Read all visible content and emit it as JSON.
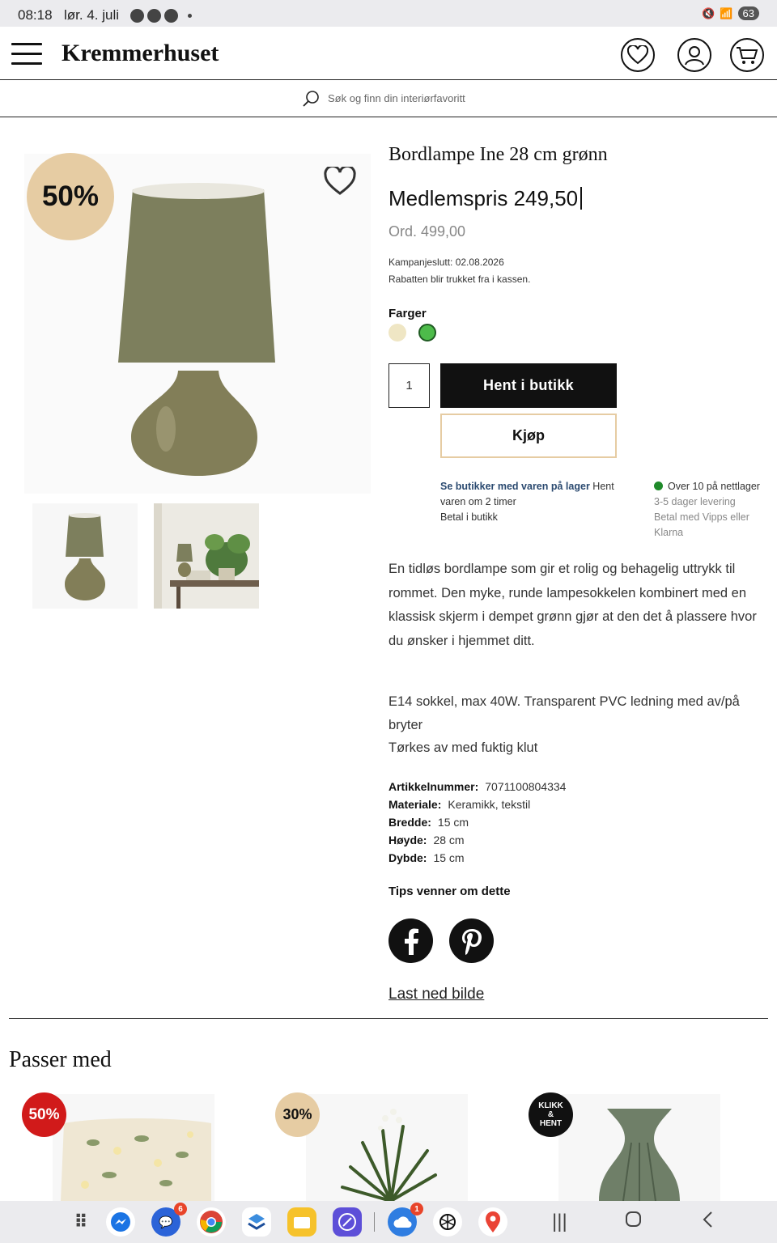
{
  "status_bar": {
    "time": "08:18",
    "date": "lør. 4. juli",
    "battery": "63"
  },
  "header": {
    "logo": "Kremmerhuset"
  },
  "search": {
    "placeholder": "Søk og finn din interiørfavoritt"
  },
  "product": {
    "discount_badge": "50%",
    "title": "Bordlampe Ine 28 cm grønn",
    "member_price": "Medlemspris 249,50",
    "ordinary_price": "Ord. 499,00",
    "campaign_end": "Kampanjeslutt: 02.08.2026",
    "discount_note": "Rabatten blir trukket fra i kassen.",
    "colors_label": "Farger",
    "colors": [
      "#efe6c4",
      "#4dbb4a"
    ],
    "quantity": "1",
    "pickup_button": "Hent i butikk",
    "buy_button": "Kjøp",
    "store_link": "Se butikker med varen på lager",
    "store_text_1": "Hent varen om 2 timer",
    "store_text_2": "Betal i butikk",
    "online_stock": "Over 10 på nettlager",
    "delivery": "3-5 dager levering",
    "payment": "Betal med Vipps eller Klarna",
    "description": "En tidløs bordlampe som gir et rolig og behagelig uttrykk til rommet. Den myke, runde lampesokkelen kombinert med en klassisk skjerm i dempet grønn gjør at den det å plassere hvor du ønsker i hjemmet ditt.",
    "description2_line1": "E14 sokkel, max 40W. Transparent PVC ledning med av/på bryter",
    "description2_line2": "Tørkes av med fuktig klut",
    "specs": [
      {
        "label": "Artikkelnummer:",
        "value": "7071100804334"
      },
      {
        "label": "Materiale:",
        "value": "Keramikk, tekstil"
      },
      {
        "label": "Bredde:",
        "value": "15 cm"
      },
      {
        "label": "Høyde:",
        "value": "28 cm"
      },
      {
        "label": "Dybde:",
        "value": "15 cm"
      }
    ],
    "share_label": "Tips venner om dette",
    "download_link": "Last ned bilde"
  },
  "recommendations": {
    "title": "Passer med",
    "items": [
      {
        "badge": "50%"
      },
      {
        "badge": "30%"
      },
      {
        "badge_line1": "KLIKK",
        "badge_line2": "&",
        "badge_line3": "HENT"
      }
    ]
  },
  "navbar": {
    "messages_badge": "6",
    "cloud_badge": "1"
  },
  "colors": {
    "accent_beige": "#e6cca3",
    "sale_red": "#d11a1a",
    "link_blue": "#2b4a70",
    "stock_green": "#1f8a2a"
  }
}
